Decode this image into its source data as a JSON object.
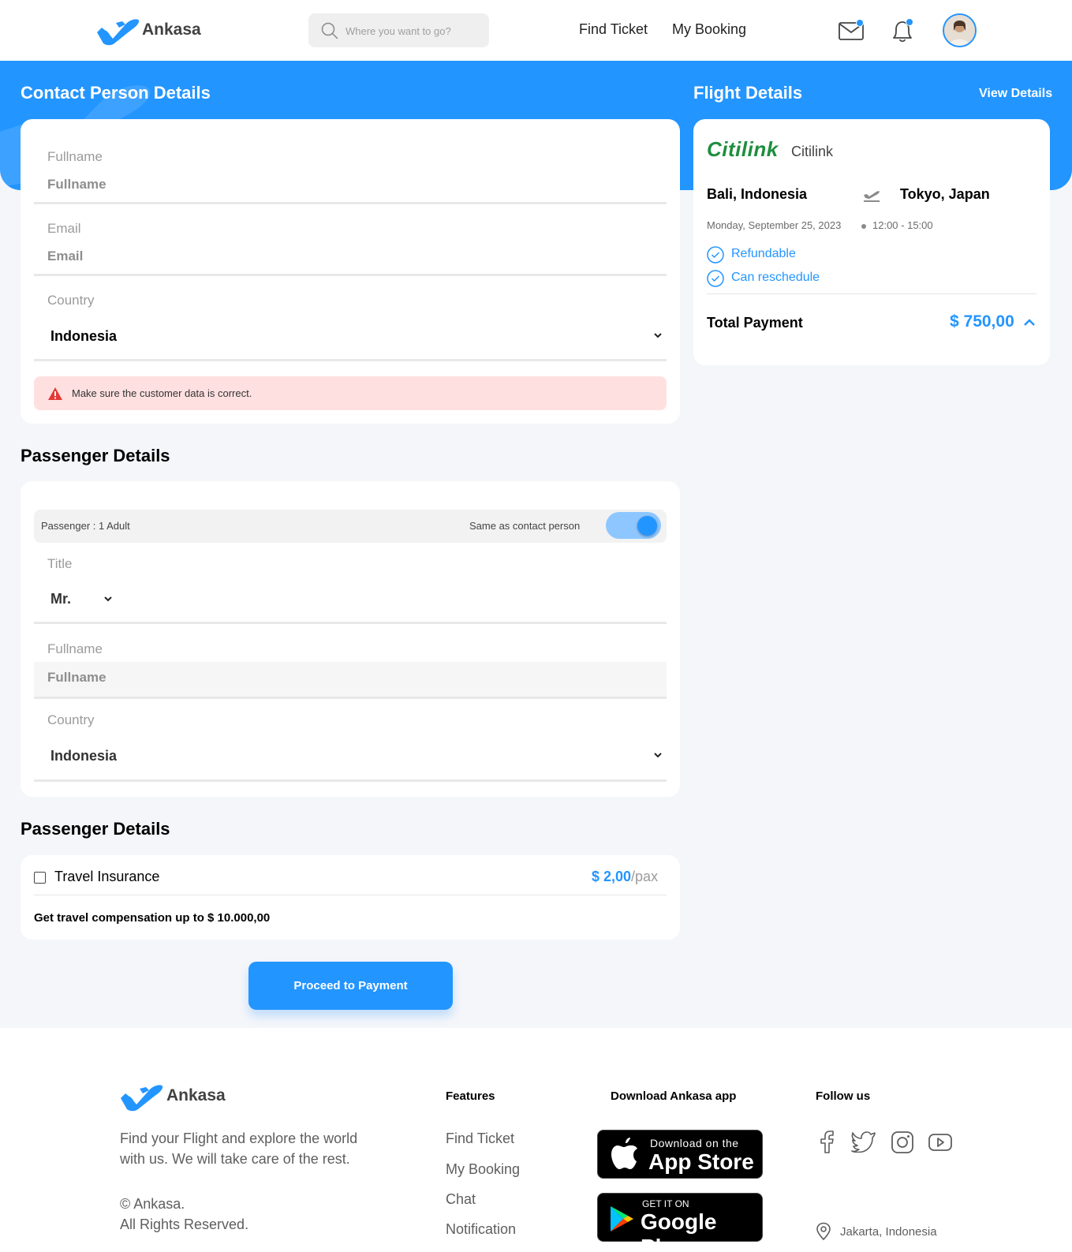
{
  "header": {
    "brand": "Ankasa",
    "search_placeholder": "Where you want to go?",
    "nav": [
      "Find Ticket",
      "My Booking"
    ]
  },
  "contact": {
    "title": "Contact Person Details",
    "fullname_label": "Fullname",
    "fullname_value": "Fullname",
    "email_label": "Email",
    "email_value": "Email",
    "country_label": "Country",
    "country_value": "Indonesia",
    "warning": "Make sure the customer data is correct."
  },
  "passenger": {
    "title": "Passenger Details",
    "count": "Passenger : 1 Adult",
    "same_as_contact": "Same as contact person",
    "same_as_contact_on": true,
    "title_label": "Title",
    "title_value": "Mr.",
    "fullname_label": "Fullname",
    "fullname_value": "Fullname",
    "country_label": "Country",
    "country_value": "Indonesia"
  },
  "insurance": {
    "title": "Passenger Details",
    "label": "Travel Insurance",
    "price": "$ 2,00",
    "per": "/pax",
    "note": "Get travel compensation up to $ 10.000,00",
    "checked": false
  },
  "proceed_button": "Proceed to Payment",
  "flight": {
    "title": "Flight Details",
    "view_details": "View Details",
    "airline_logo_text": "Citilink",
    "airline": "Citilink",
    "from": "Bali, Indonesia",
    "to": "Tokyo, Japan",
    "date": "Monday, September 25, 2023",
    "time": "12:00 - 15:00",
    "features": [
      "Refundable",
      "Can reschedule"
    ],
    "total_label": "Total Payment",
    "total_value": "$ 750,00"
  },
  "footer": {
    "brand": "Ankasa",
    "tagline": "Find your Flight and explore the world with us. We will take care of the rest.",
    "copyright": "© Ankasa.",
    "rights": "All Rights Reserved.",
    "features_title": "Features",
    "features": [
      "Find Ticket",
      "My Booking",
      "Chat",
      "Notification"
    ],
    "download_title": "Download Ankasa app",
    "appstore_small": "Download on the",
    "appstore_big": "App Store",
    "googleplay_small": "GET IT ON",
    "googleplay_big": "Google Play",
    "follow_title": "Follow us",
    "social_icons": [
      "facebook-icon",
      "twitter-icon",
      "instagram-icon",
      "youtube-icon"
    ],
    "location": "Jakarta, Indonesia"
  },
  "colors": {
    "primary": "#2395FF",
    "background": "#F5F6FA",
    "warning_bg": "#FFE0E0",
    "warning_icon": "#E53935",
    "citilink_green": "#1E8E3E"
  }
}
